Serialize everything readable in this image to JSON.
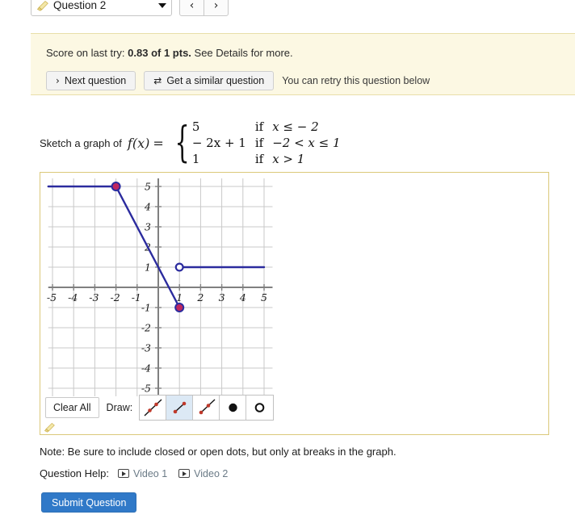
{
  "topbar": {
    "question_label": "Question 2",
    "question_icon": "pencil-check-icon",
    "prev_label": "‹",
    "next_label": "›"
  },
  "banner": {
    "score_prefix": "Score on last try: ",
    "score_value": "0.83 of 1 pts.",
    "score_suffix": " See Details for more.",
    "next_question_label": "Next question",
    "next_question_glyph": "›",
    "similar_question_label": "Get a similar question",
    "similar_question_glyph": "⇄",
    "retry_note": "You can retry this question below"
  },
  "prompt": {
    "lead": "Sketch a graph of",
    "function_name": "f(x)",
    "equals": "=",
    "cases": [
      {
        "value": "5",
        "if": "if",
        "condition": "x ≤ − 2"
      },
      {
        "value": "− 2x + 1",
        "if": "if",
        "condition": "−2 < x ≤ 1"
      },
      {
        "value": "1",
        "if": "if",
        "condition": "x > 1"
      }
    ]
  },
  "chart_data": {
    "type": "line",
    "title": "",
    "xlabel": "",
    "ylabel": "",
    "xlim": [
      -5.2,
      5.4
    ],
    "ylim": [
      -5.4,
      5.4
    ],
    "xticks": [
      -5,
      -4,
      -3,
      -2,
      -1,
      1,
      2,
      3,
      4,
      5
    ],
    "yticks": [
      5,
      4,
      3,
      2,
      1,
      -1,
      -2,
      -3,
      -4,
      -5
    ],
    "grid": true,
    "legend": "none",
    "curve_color": "#2b2b9e",
    "closed_dot_fill": "#c0275f",
    "closed_dot_stroke": "#2b2b9e",
    "open_dot_stroke": "#2b2b9e",
    "axis_color": "#808080",
    "grid_color": "#c9c9c9",
    "series": [
      {
        "name": "constant-left",
        "kind": "segment",
        "points": [
          [
            -5.2,
            5
          ],
          [
            -2,
            5
          ]
        ]
      },
      {
        "name": "linear-middle",
        "kind": "segment",
        "points": [
          [
            -2,
            5
          ],
          [
            1,
            -1
          ]
        ]
      },
      {
        "name": "constant-right",
        "kind": "segment",
        "points": [
          [
            1,
            1
          ],
          [
            5,
            1
          ]
        ]
      }
    ],
    "closed_dots": [
      [
        -2,
        5
      ],
      [
        1,
        -1
      ]
    ],
    "open_dots": [
      [
        1,
        1
      ]
    ]
  },
  "toolbar": {
    "clear_all_label": "Clear All",
    "draw_label": "Draw:",
    "tools": [
      {
        "name": "line-tool",
        "selected": false
      },
      {
        "name": "segment-tool",
        "selected": true
      },
      {
        "name": "ray-tool",
        "selected": false
      },
      {
        "name": "closed-dot-tool",
        "selected": false
      },
      {
        "name": "open-dot-tool",
        "selected": false
      }
    ]
  },
  "footer": {
    "note": "Note: Be sure to include closed or open dots, but only at breaks in the graph.",
    "question_help_label": "Question Help:",
    "video_links": [
      "Video 1",
      "Video 2"
    ],
    "submit_label": "Submit Question"
  }
}
